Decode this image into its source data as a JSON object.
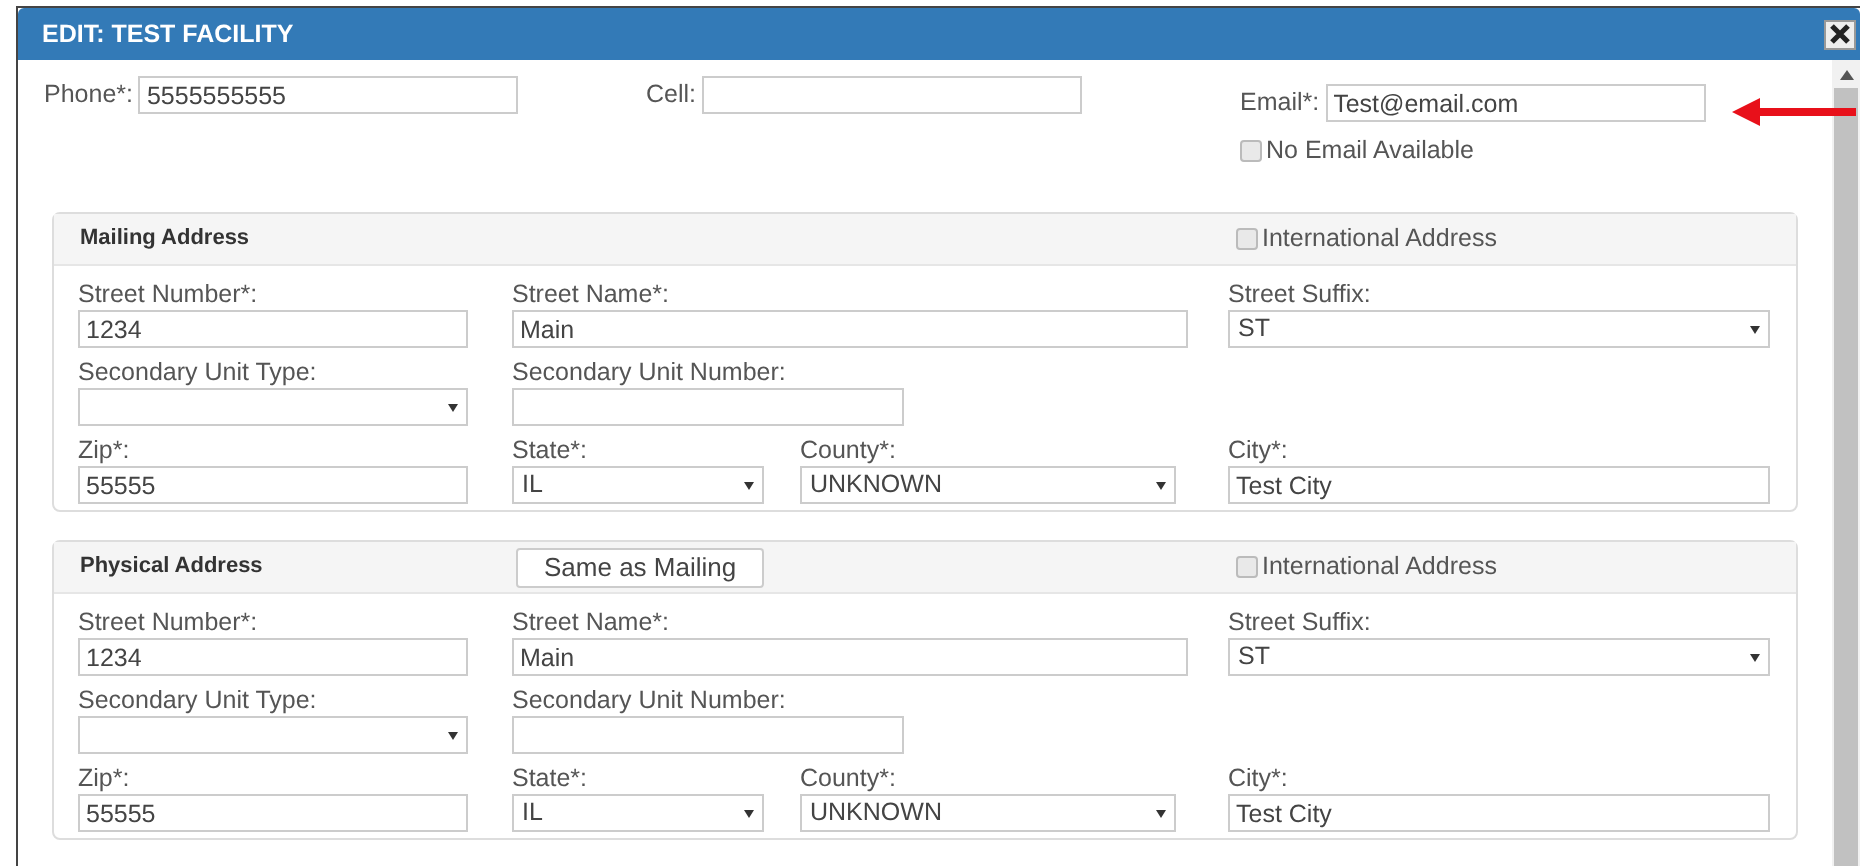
{
  "window": {
    "title": "EDIT: TEST FACILITY"
  },
  "contact": {
    "phone": {
      "label": "Phone*:",
      "value": "5555555555"
    },
    "cell": {
      "label": "Cell:"
    },
    "email": {
      "label": "Email*:",
      "value": "Test@email.com"
    },
    "no_email": {
      "label": "No Email Available",
      "checked": false
    }
  },
  "addresses": [
    {
      "title": "Mailing Address",
      "international": {
        "label": "International Address",
        "checked": false
      },
      "fields": [
        {
          "label": "Street Number*:",
          "value": "1234",
          "kind": "text"
        },
        {
          "label": "Street Name*:",
          "value": "Main",
          "kind": "text"
        },
        {
          "label": "Street Suffix:",
          "value": "ST",
          "kind": "select"
        },
        {
          "label": "Secondary Unit Type:",
          "kind": "select"
        },
        {
          "label": "Secondary Unit Number:",
          "kind": "text"
        },
        {
          "label": "Zip*:",
          "value": "55555",
          "kind": "text"
        },
        {
          "label": "State*:",
          "value": "IL",
          "kind": "select"
        },
        {
          "label": "County*:",
          "value": "UNKNOWN",
          "kind": "select"
        },
        {
          "label": "City*:",
          "value": "Test City",
          "kind": "text"
        }
      ]
    },
    {
      "title": "Physical Address",
      "button": "Same as Mailing",
      "international": {
        "label": "International Address",
        "checked": false
      },
      "fields": [
        {
          "label": "Street Number*:",
          "value": "1234",
          "kind": "text"
        },
        {
          "label": "Street Name*:",
          "value": "Main",
          "kind": "text"
        },
        {
          "label": "Street Suffix:",
          "value": "ST",
          "kind": "select"
        },
        {
          "label": "Secondary Unit Type:",
          "kind": "select"
        },
        {
          "label": "Secondary Unit Number:",
          "kind": "text"
        },
        {
          "label": "Zip*:",
          "value": "55555",
          "kind": "text"
        },
        {
          "label": "State*:",
          "value": "IL",
          "kind": "select"
        },
        {
          "label": "County*:",
          "value": "UNKNOWN",
          "kind": "select"
        },
        {
          "label": "City*:",
          "value": "Test City",
          "kind": "text"
        }
      ]
    }
  ]
}
